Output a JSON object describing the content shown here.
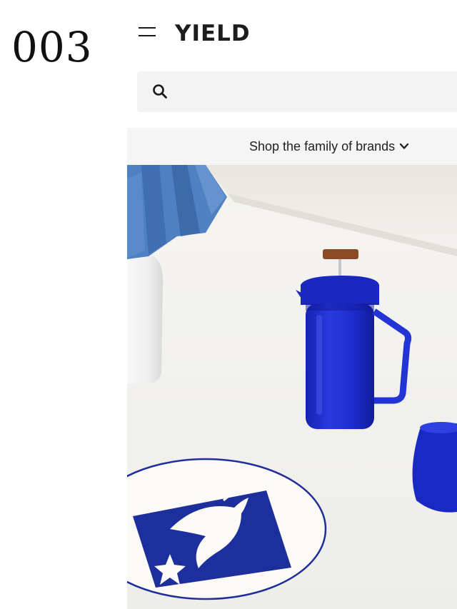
{
  "page": {
    "index_number": "003"
  },
  "header": {
    "logo_text": "YIELD",
    "menu_icon": "hamburger-menu-icon"
  },
  "search": {
    "icon": "search-icon",
    "value": "",
    "placeholder": ""
  },
  "brands_bar": {
    "label": "Shop the family of brands",
    "icon": "chevron-down-icon"
  },
  "hero": {
    "products": [
      "glass french press",
      "glass tumbler",
      "printed ceramic plate",
      "pleated lamp shade"
    ],
    "colors": {
      "cobalt": "#1f2fc8",
      "background": "#f1f0ec",
      "shade": "#4d7fc0"
    }
  }
}
